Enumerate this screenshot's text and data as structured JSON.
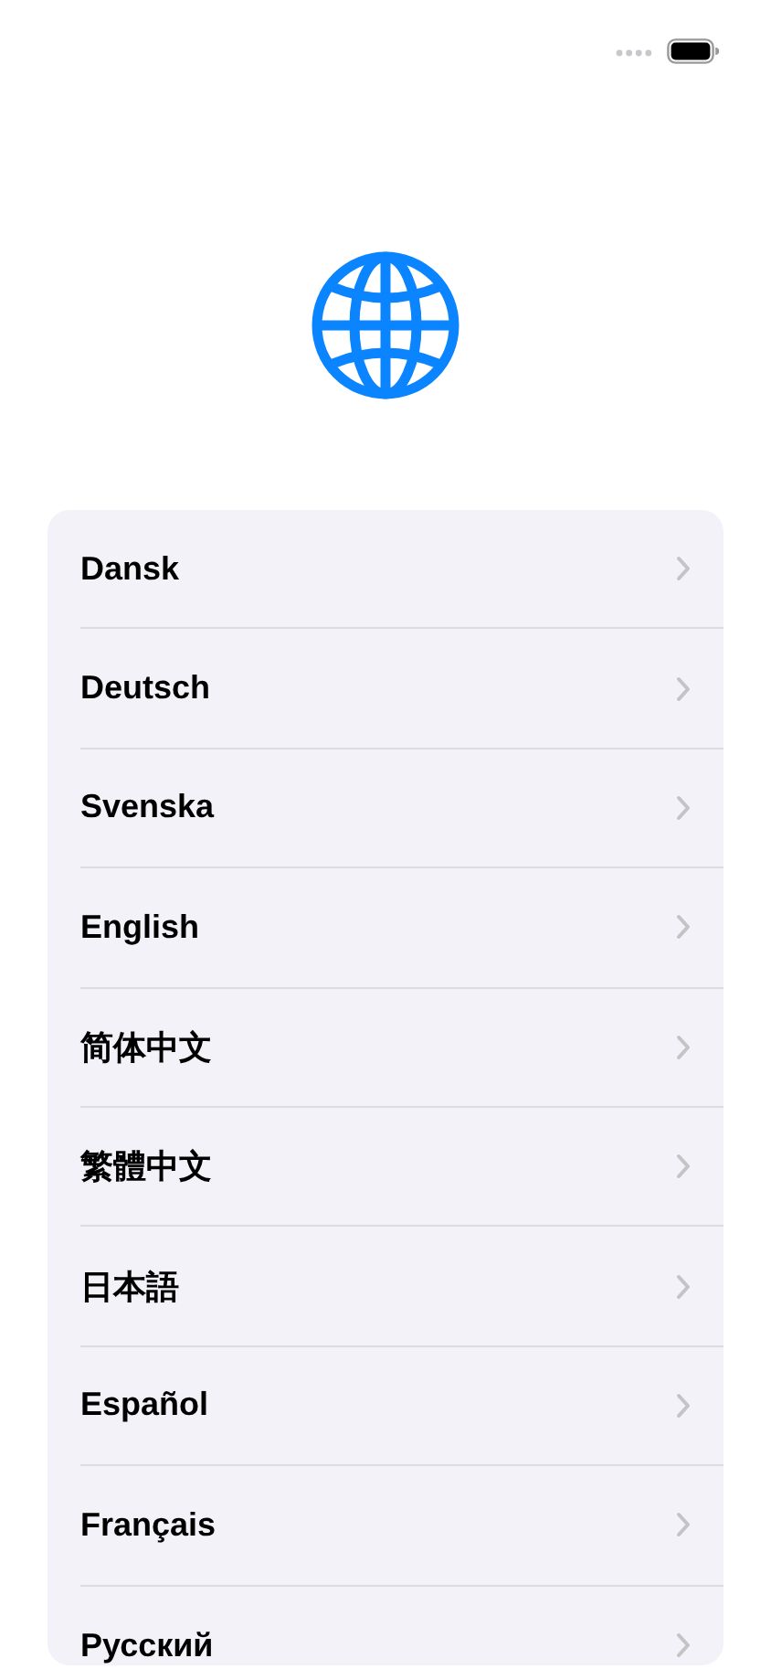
{
  "languages": [
    {
      "label": "Dansk"
    },
    {
      "label": "Deutsch"
    },
    {
      "label": "Svenska"
    },
    {
      "label": "English"
    },
    {
      "label": "简体中文"
    },
    {
      "label": "繁體中文"
    },
    {
      "label": "日本語"
    },
    {
      "label": "Español"
    },
    {
      "label": "Français"
    },
    {
      "label": "Русский"
    }
  ]
}
